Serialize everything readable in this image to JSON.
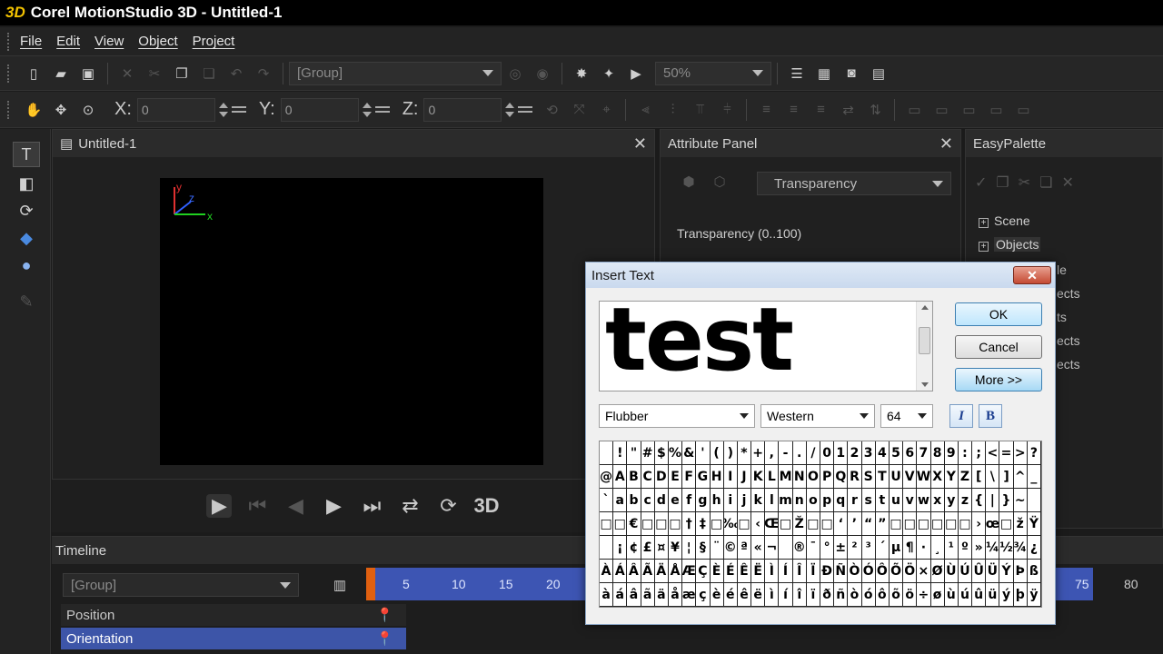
{
  "window": {
    "logo": "3D",
    "title": "Corel MotionStudio 3D - Untitled-1"
  },
  "menu": [
    "File",
    "Edit",
    "View",
    "Object",
    "Project"
  ],
  "toolbar1": {
    "object_combo": "[Group]",
    "zoom_combo": "50%"
  },
  "toolbar2": {
    "x_label": "X:",
    "x_value": "0",
    "y_label": "Y:",
    "y_value": "0",
    "z_label": "Z:",
    "z_value": "0"
  },
  "document": {
    "title": "Untitled-1"
  },
  "axes": {
    "y": "y",
    "z": "z",
    "x": "x"
  },
  "playback": {
    "label_3d": "3D"
  },
  "timeline": {
    "title": "Timeline",
    "group_combo": "[Group]",
    "tracks": [
      "Position",
      "Orientation"
    ],
    "ruler_ticks": [
      "5",
      "10",
      "15",
      "20",
      "75",
      "80"
    ]
  },
  "attribute_panel": {
    "title": "Attribute Panel",
    "combo": "Transparency",
    "transparency_label": "Transparency (0..100)"
  },
  "easy_palette": {
    "title": "EasyPalette",
    "tree": [
      "Scene",
      "Objects"
    ],
    "partial_items": [
      "le",
      "ects",
      "ts",
      "ects",
      "ects"
    ]
  },
  "dialog": {
    "title": "Insert Text",
    "close": "✕",
    "preview_text": "test",
    "ok": "OK",
    "cancel": "Cancel",
    "more": "More >>",
    "font": "Flubber",
    "script": "Western",
    "size": "64",
    "italic": "I",
    "bold": "B",
    "charmap_rows": [
      " !\"#$%&'()*+,-./0123456789:;<=>?",
      "@ABCDEFGHIJKLMNOPQRSTUVWXYZ[\\]^_",
      "`abcdefghijklmnopqrstuvwxyz{|}~ ",
      "□□€□□□†‡□‰□‹Œ□Ž□□‘’“”□□□□□□›œ□žŸ",
      " ¡¢£¤¥¦§¨©ª«¬­®¯°±²³´µ¶·¸¹º»¼½¾¿",
      "ÀÁÂÃÄÅÆÇÈÉÊËÌÍÎÏÐÑÒÓÔÕÖ×ØÙÚÛÜÝÞß",
      "àáâãäåæçèéêëìíîïðñòóôõö÷øùúûüýþÿ"
    ]
  }
}
